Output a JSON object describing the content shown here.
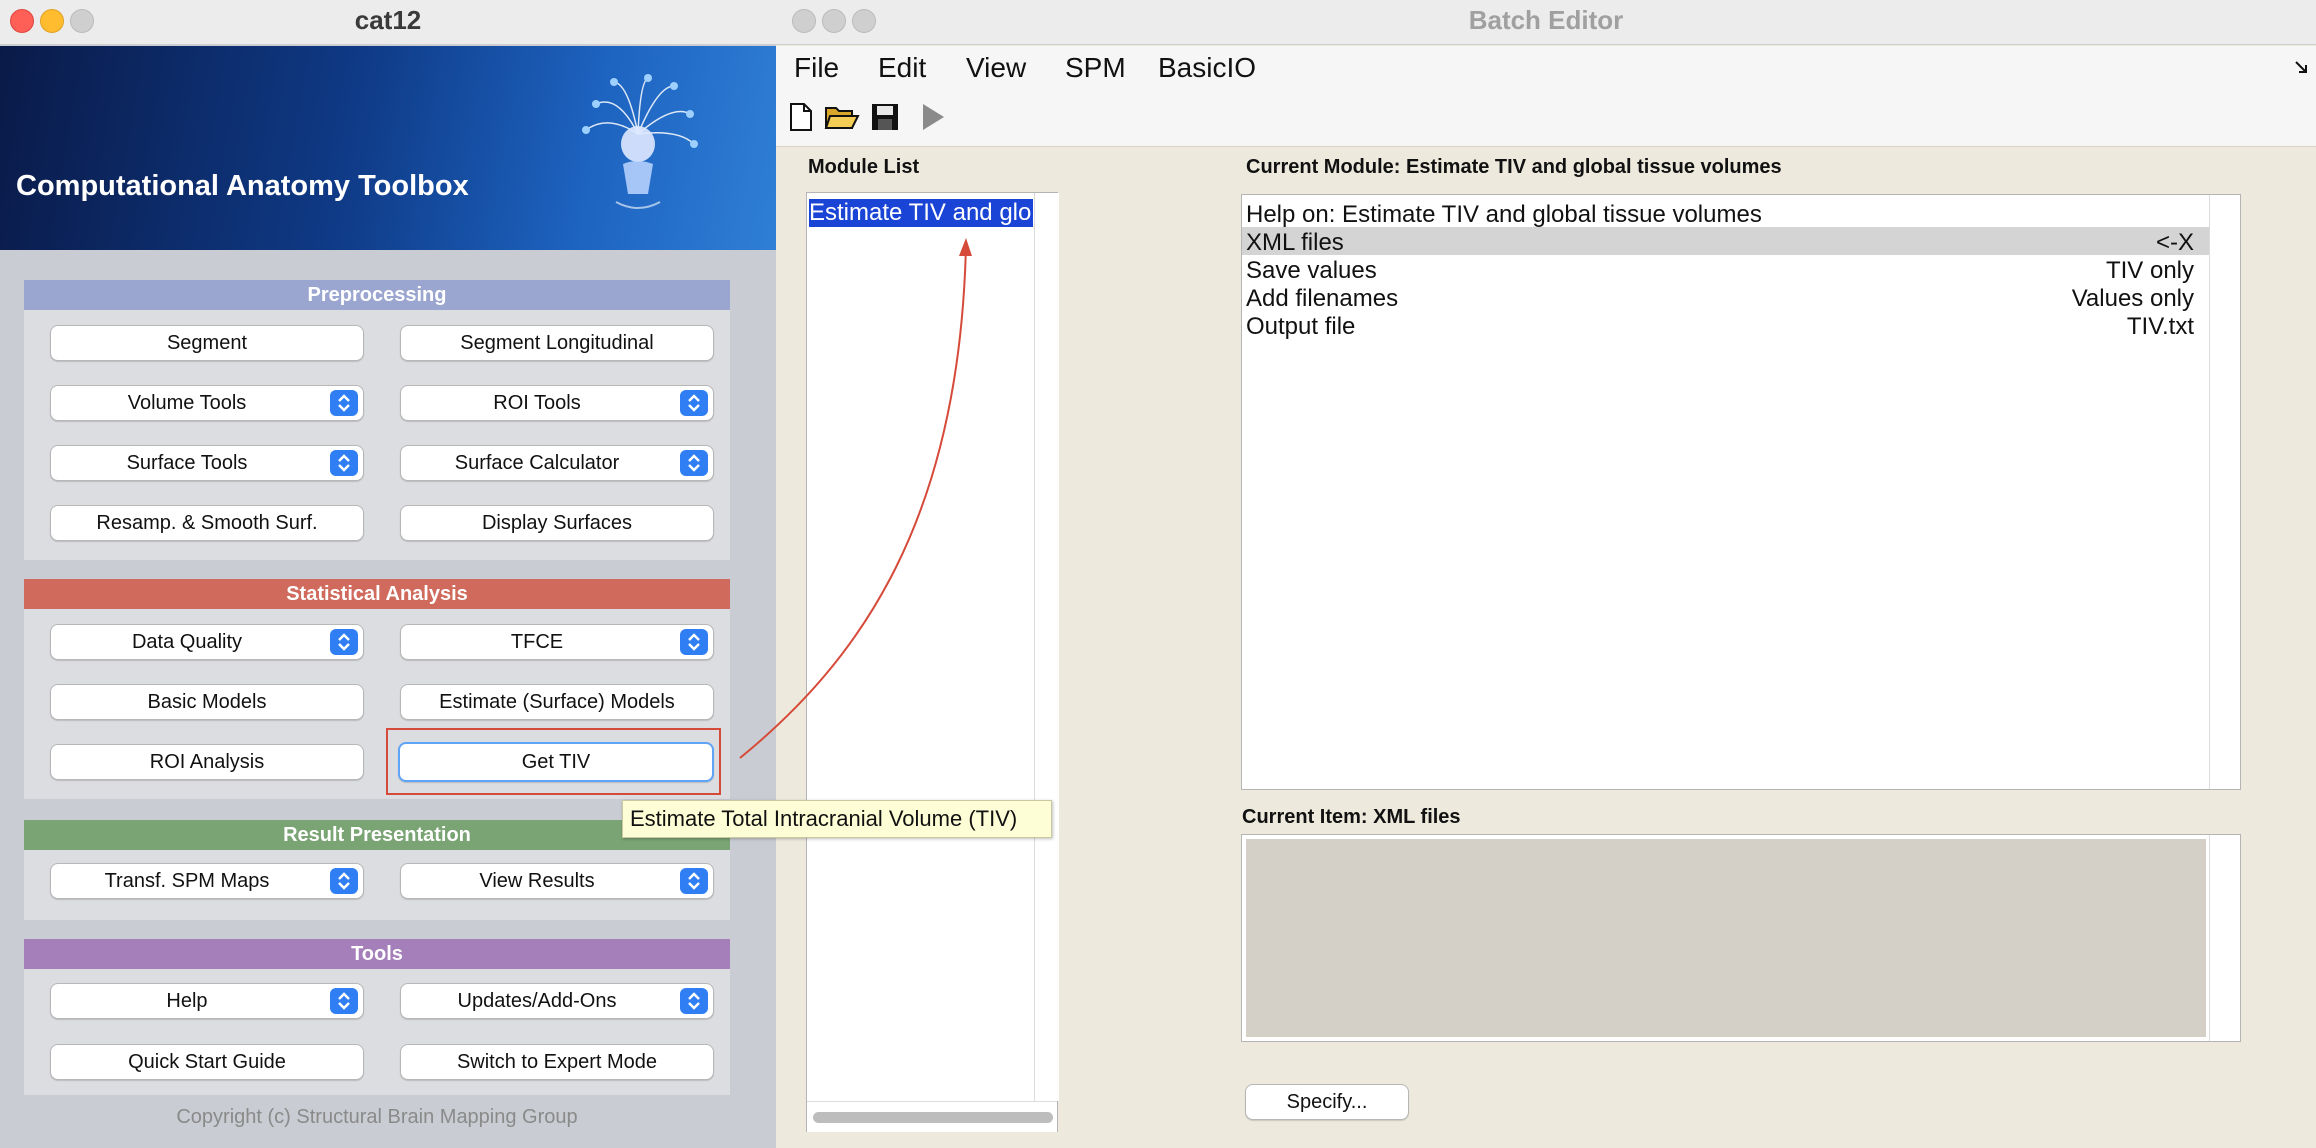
{
  "cat_window": {
    "title": "cat12",
    "banner_title": "Computational Anatomy Toolbox",
    "sections": {
      "preprocessing": "Preprocessing",
      "statistical": "Statistical Analysis",
      "results": "Result Presentation",
      "tools": "Tools"
    },
    "buttons": {
      "segment": "Segment",
      "segment_longitudinal": "Segment Longitudinal",
      "volume_tools": "Volume Tools",
      "roi_tools": "ROI Tools",
      "surface_tools": "Surface Tools",
      "surface_calculator": "Surface Calculator",
      "resamp_smooth": "Resamp. & Smooth Surf.",
      "display_surfaces": "Display Surfaces",
      "data_quality": "Data Quality",
      "tfce": "TFCE",
      "basic_models": "Basic Models",
      "estimate_models": "Estimate (Surface) Models",
      "roi_analysis": "ROI Analysis",
      "get_tiv": "Get TIV",
      "transf_spm_maps": "Transf. SPM Maps",
      "view_results": "View Results",
      "help": "Help",
      "updates_addons": "Updates/Add-Ons",
      "quick_start": "Quick Start Guide",
      "expert_mode": "Switch to Expert Mode"
    },
    "tooltip": "Estimate Total Intracranial Volume (TIV)",
    "copyright": "Copyright (c) Structural Brain Mapping Group"
  },
  "batch_editor": {
    "title": "Batch Editor",
    "menu": [
      "File",
      "Edit",
      "View",
      "SPM",
      "BasicIO"
    ],
    "module_list_label": "Module List",
    "module_list_items": [
      "Estimate TIV and global tissue v"
    ],
    "current_module_label": "Current Module: Estimate TIV and global tissue volumes",
    "module_rows": [
      {
        "label": "Help on: Estimate TIV and global tissue volumes",
        "value": ""
      },
      {
        "label": "XML files",
        "value": "<-X"
      },
      {
        "label": "Save values",
        "value": "TIV only"
      },
      {
        "label": "Add filenames",
        "value": "Values only"
      },
      {
        "label": "Output file",
        "value": "TIV.txt"
      }
    ],
    "current_item_label": "Current Item: XML files",
    "specify_button": "Specify..."
  },
  "colors": {
    "preprocessing_bar": "#9aa6cf",
    "statistical_bar": "#cf6a5c",
    "results_bar": "#7aa474",
    "tools_bar": "#a57fb9",
    "selection": "#1a44d6",
    "annotation": "#d64a3a",
    "tooltip_bg": "#fefed6"
  }
}
